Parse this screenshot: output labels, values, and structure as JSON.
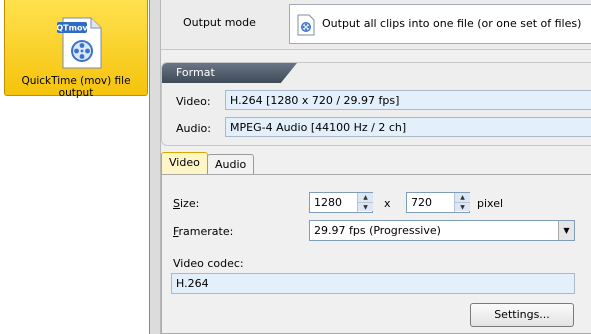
{
  "preset": {
    "label": "QuickTime (mov) file output",
    "icon_badge": "QTmov"
  },
  "output_mode": {
    "label": "Output mode",
    "value": "Output all clips into one file (or one set of files)"
  },
  "format": {
    "header": "Format",
    "video_label": "Video:",
    "video_value": "H.264 [1280 x 720 / 29.97 fps]",
    "audio_label": "Audio:",
    "audio_value": "MPEG-4 Audio [44100 Hz / 2 ch]"
  },
  "tabs": [
    {
      "label": "Video",
      "active": true
    },
    {
      "label": "Audio",
      "active": false
    }
  ],
  "video_tab": {
    "size_label_first": "S",
    "size_label_rest": "ize:",
    "width": "1280",
    "x_sep": "x",
    "height": "720",
    "unit": "pixel",
    "framerate_label_first": "F",
    "framerate_label_rest": "ramerate:",
    "framerate_value": "29.97  fps (Progressive)",
    "codec_label": "Video codec:",
    "codec_value": "H.264",
    "settings_button": "Settings..."
  },
  "colors": {
    "preset_bg": "#f5c30c",
    "active_tab": "#fff6c8",
    "format_header": "#4a5563",
    "field_bg": "#e3f0fb"
  }
}
